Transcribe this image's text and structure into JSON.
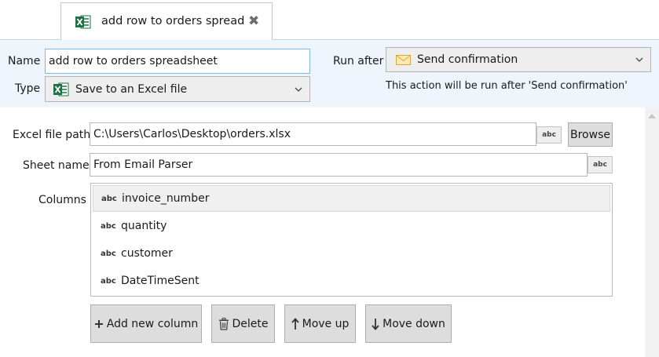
{
  "tab": {
    "title": "add row to orders spreadsheet",
    "icon": "excel-icon",
    "close_icon": "close-icon"
  },
  "header": {
    "name_label": "Name",
    "name_value": "add row to orders spreadsheet",
    "type_label": "Type",
    "type_value": "Save to an Excel file",
    "type_icon": "excel-icon",
    "run_after_label": "Run after",
    "run_after_value": "Send confirmation",
    "run_after_icon": "envelope-icon",
    "run_after_hint": "This action will be run after 'Send confirmation'"
  },
  "form": {
    "excel_path_label": "Excel file path",
    "excel_path_value": "C:\\Users\\Carlos\\Desktop\\orders.xlsx",
    "abc_label": "abc",
    "browse_label": "Browse",
    "sheet_label": "Sheet name",
    "sheet_value": "From Email Parser",
    "columns_label": "Columns",
    "columns": [
      {
        "type": "abc",
        "name": "invoice_number"
      },
      {
        "type": "abc",
        "name": "quantity"
      },
      {
        "type": "abc",
        "name": "customer"
      },
      {
        "type": "abc",
        "name": "DateTimeSent"
      }
    ]
  },
  "actions": {
    "add_label": "Add new column",
    "delete_label": "Delete",
    "move_up_label": "Move up",
    "move_down_label": "Move down"
  },
  "colors": {
    "header_bg": "#eef5fc",
    "excel_green": "#1e7145",
    "focus_border": "#7eb4ea",
    "button_bg": "#dddddd"
  }
}
